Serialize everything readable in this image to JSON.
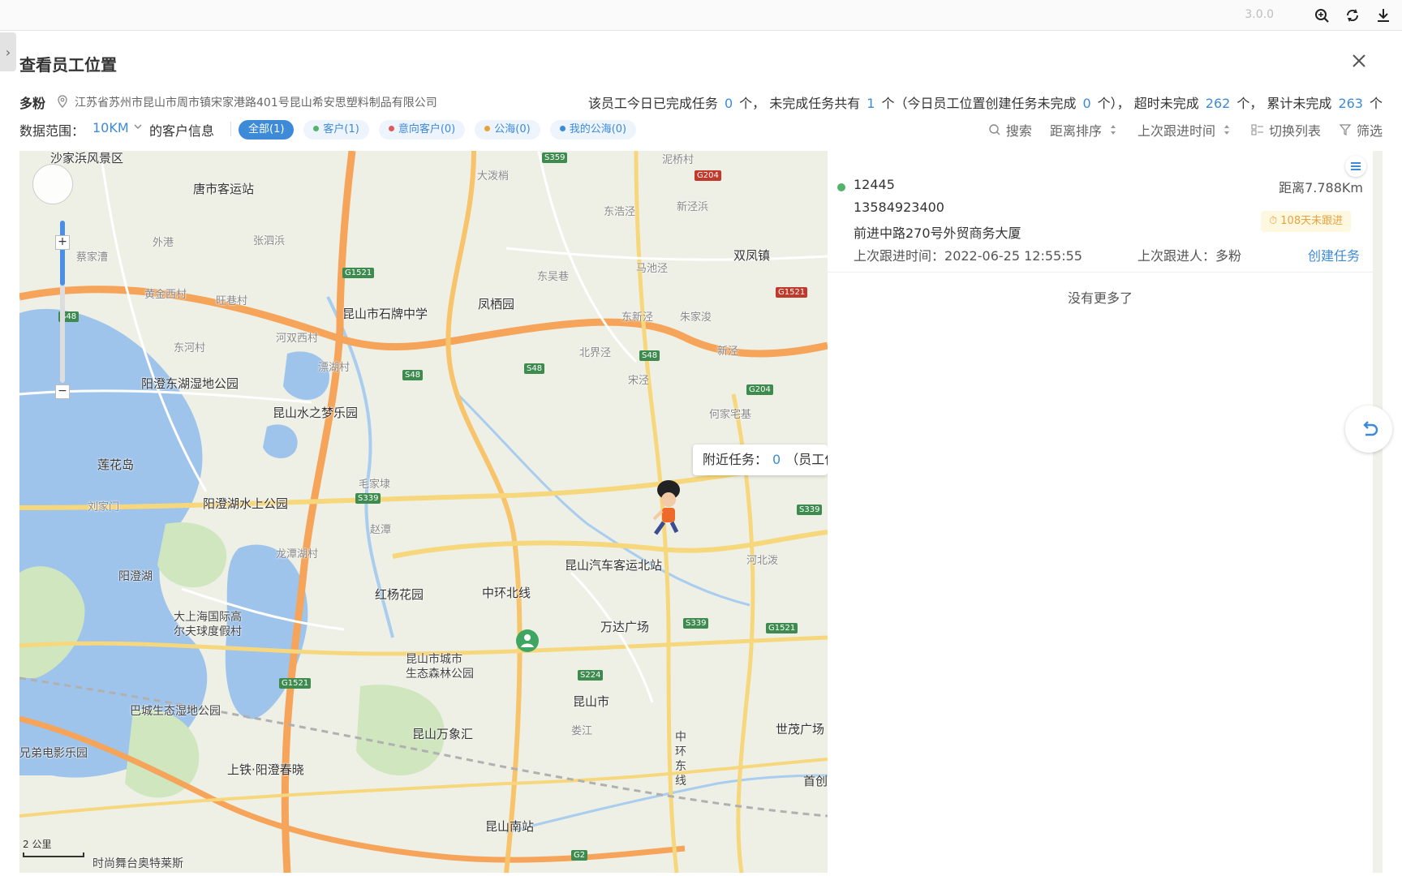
{
  "app": {
    "version": "3.0.0",
    "title": "查看员工位置"
  },
  "info": {
    "employee": "多粉",
    "address": "江苏省苏州市昆山市周市镇宋家港路401号昆山希安思塑料制品有限公司",
    "stats_prefix": "该员工今日已完成任务",
    "completed_today": "0",
    "unit": "个，",
    "pending_label": "未完成任务共有",
    "pending": "1",
    "pending_note_prefix": "个（今日员工位置创建任务未完成",
    "pending_created": "0",
    "pending_note_suffix": "个），",
    "overdue_label": "超时未完成",
    "overdue": "262",
    "unit2": "个，",
    "total_label": "累计未完成",
    "total_pending": "263",
    "unit3": "个"
  },
  "filters": {
    "range_label": "数据范围：",
    "range_value": "10KM",
    "customer_info": "的客户信息",
    "chips": [
      {
        "label": "全部(1)",
        "active": true
      },
      {
        "label": "客户(1)",
        "dot": "#52b36a"
      },
      {
        "label": "意向客户(0)",
        "dot": "#e05a5a"
      },
      {
        "label": "公海(0)",
        "dot": "#e6a23c"
      },
      {
        "label": "我的公海(0)",
        "dot": "#3d8ad9"
      }
    ],
    "tools": {
      "search": "搜索",
      "distance_sort": "距离排序",
      "last_follow_time": "上次跟进时间",
      "switch_list": "切换列表",
      "filter": "筛选"
    }
  },
  "map": {
    "tooltip_prefix": "附近任务：",
    "tooltip_count": "0",
    "tooltip_suffix": "（员工位",
    "scale": "2 公里",
    "places": {
      "p1": "沙家浜风景区",
      "p2": "唐市客运站",
      "p3": "昆山市石牌中学",
      "p4": "凤栖园",
      "p5": "双凤镇",
      "p6": "阳澄东湖湿地公园",
      "p7": "昆山水之梦乐园",
      "p8": "莲花岛",
      "p9": "阳澄湖水上公园",
      "p10": "阳澄湖",
      "p11": "红杨花园",
      "p12": "中环北线",
      "p13": "昆山汽车客运北站",
      "p14": "万达广场",
      "p15": "大上海国际高",
      "p16": "尔夫球度假村",
      "p17": "昆山市城市",
      "p18": "生态森林公园",
      "p19": "巴城生态湿地公园",
      "p20": "昆山万象汇",
      "p21": "昆山市",
      "p22": "世茂广场",
      "p23": "兄弟电影乐园",
      "p24": "上铁·阳澄春晓",
      "p25": "昆山南站",
      "p26": "时尚舞台奥特莱斯",
      "p27": "首创",
      "p28": "娄江",
      "p29": "何家宅基",
      "p30": "北界泾",
      "p31": "大泼梢",
      "p32": "泥桥村",
      "p33": "新泾浜",
      "p34": "东浩泾",
      "p35": "马池泾",
      "p36": "东吴巷",
      "p37": "朱家浚",
      "p38": "东新泾",
      "p39": "宋泾",
      "p40": "新泾",
      "p41": "漂湖村",
      "p42": "东河村",
      "p43": "黄金西村",
      "p44": "旺巷村",
      "p45": "河双西村",
      "p46": "外港",
      "p47": "蔡家漕",
      "p48": "张泗浜",
      "p49": "刘家门",
      "p50": "龙潭湖村",
      "p51": "毛家埭",
      "p52": "赵潭",
      "p53": "河北泼",
      "p54": "中",
      "p55": "环",
      "p56": "东",
      "p57": "线"
    },
    "road_tags": [
      "S359",
      "G204",
      "G1521",
      "S48",
      "S48",
      "S48",
      "S48",
      "G204",
      "G1521",
      "S339",
      "S339",
      "S339",
      "G1521",
      "S224",
      "G1521",
      "G2"
    ]
  },
  "panel": {
    "code": "12445",
    "distance": "距离7.788Km",
    "phone": "13584923400",
    "badge": "108天未跟进",
    "address": "前进中路270号外贸商务大厦",
    "last_time_label": "上次跟进时间：",
    "last_time": "2022-06-25 12:55:55",
    "last_person_label": "上次跟进人：",
    "last_person": "多粉",
    "create_task": "创建任务",
    "no_more": "没有更多了"
  }
}
